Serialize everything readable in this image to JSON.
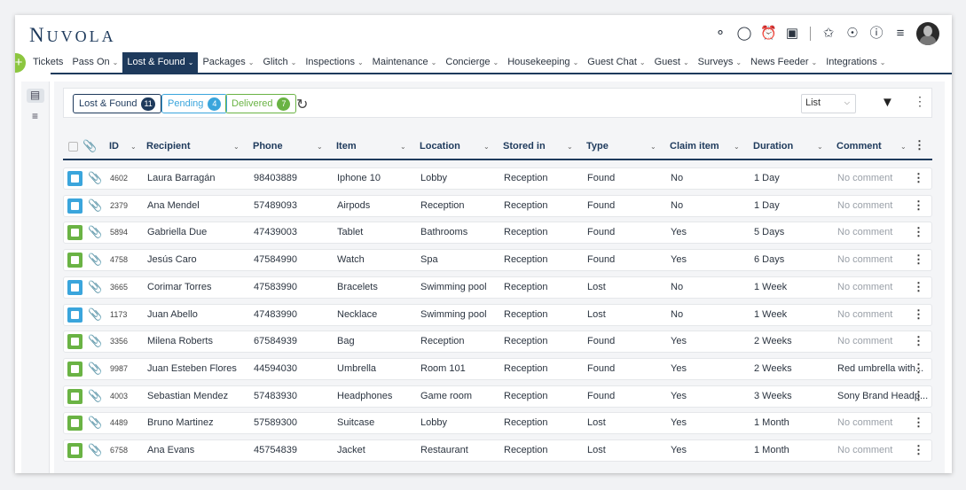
{
  "app": {
    "logo_first": "N",
    "logo_rest": "UVOLA"
  },
  "nav": {
    "plus": "+",
    "items": [
      {
        "label": "Tickets"
      },
      {
        "label": "Pass On"
      },
      {
        "label": "Lost & Found"
      },
      {
        "label": "Packages"
      },
      {
        "label": "Glitch"
      },
      {
        "label": "Inspections"
      },
      {
        "label": "Maintenance"
      },
      {
        "label": "Concierge"
      },
      {
        "label": "Housekeeping"
      },
      {
        "label": "Guest Chat"
      },
      {
        "label": "Guest"
      },
      {
        "label": "Surveys"
      },
      {
        "label": "News Feeder"
      },
      {
        "label": "Integrations"
      }
    ],
    "active_index": 2
  },
  "header_icons": [
    "chat-bubble-icon",
    "message-icon",
    "alarm-clock-icon",
    "calendar-icon",
    "magic-wand-icon",
    "globe-icon",
    "help-icon",
    "settings-sliders-icon"
  ],
  "toolbar": {
    "lost_found_label": "Lost & Found",
    "lost_found_count": "11",
    "pending_label": "Pending",
    "pending_count": "4",
    "delivered_label": "Delivered",
    "delivered_count": "7",
    "view_value": "List"
  },
  "columns": {
    "id": "ID",
    "recipient": "Recipient",
    "phone": "Phone",
    "item": "Item",
    "location": "Location",
    "stored_in": "Stored in",
    "type": "Type",
    "claim_item": "Claim item",
    "duration": "Duration",
    "comment": "Comment"
  },
  "colors": {
    "brand": "#1e3a5c",
    "pending": "#3aa5dc",
    "delivered": "#6ab344",
    "add_button": "#8cc63f"
  },
  "rows": [
    {
      "status": "pending",
      "id": "4602",
      "recipient": "Laura Barragán",
      "phone": "98403889",
      "item": "Iphone 10",
      "location": "Lobby",
      "stored_in": "Reception",
      "type": "Found",
      "claim": "No",
      "duration": "1 Day",
      "comment": "No comment",
      "comment_empty": true
    },
    {
      "status": "pending",
      "id": "2379",
      "recipient": "Ana Mendel",
      "phone": "57489093",
      "item": "Airpods",
      "location": "Reception",
      "stored_in": "Reception",
      "type": "Found",
      "claim": "No",
      "duration": "1 Day",
      "comment": "No comment",
      "comment_empty": true
    },
    {
      "status": "delivered",
      "id": "5894",
      "recipient": "Gabriella Due",
      "phone": "47439003",
      "item": "Tablet",
      "location": "Bathrooms",
      "stored_in": "Reception",
      "type": "Found",
      "claim": "Yes",
      "duration": "5 Days",
      "comment": "No comment",
      "comment_empty": true
    },
    {
      "status": "delivered",
      "id": "4758",
      "recipient": "Jesús Caro",
      "phone": "47584990",
      "item": "Watch",
      "location": "Spa",
      "stored_in": "Reception",
      "type": "Found",
      "claim": "Yes",
      "duration": "6 Days",
      "comment": "No comment",
      "comment_empty": true
    },
    {
      "status": "pending",
      "id": "3665",
      "recipient": "Corimar Torres",
      "phone": "47583990",
      "item": "Bracelets",
      "location": "Swimming pool",
      "stored_in": "Reception",
      "type": "Lost",
      "claim": "No",
      "duration": "1 Week",
      "comment": "No comment",
      "comment_empty": true
    },
    {
      "status": "pending",
      "id": "1173",
      "recipient": "Juan Abello",
      "phone": "47483990",
      "item": "Necklace",
      "location": "Swimming pool",
      "stored_in": "Reception",
      "type": "Lost",
      "claim": "No",
      "duration": "1 Week",
      "comment": "No comment",
      "comment_empty": true
    },
    {
      "status": "delivered",
      "id": "3356",
      "recipient": "Milena Roberts",
      "phone": "67584939",
      "item": "Bag",
      "location": "Reception",
      "stored_in": "Reception",
      "type": "Found",
      "claim": "Yes",
      "duration": "2 Weeks",
      "comment": "No comment",
      "comment_empty": true
    },
    {
      "status": "delivered",
      "id": "9987",
      "recipient": "Juan Esteben Flores",
      "phone": "44594030",
      "item": "Umbrella",
      "location": "Room 101",
      "stored_in": "Reception",
      "type": "Found",
      "claim": "Yes",
      "duration": "2 Weeks",
      "comment": "Red umbrella with...",
      "comment_empty": false
    },
    {
      "status": "delivered",
      "id": "4003",
      "recipient": "Sebastian Mendez",
      "phone": "57483930",
      "item": "Headphones",
      "location": "Game room",
      "stored_in": "Reception",
      "type": "Found",
      "claim": "Yes",
      "duration": "3 Weeks",
      "comment": "Sony Brand Headp...",
      "comment_empty": false
    },
    {
      "status": "delivered",
      "id": "4489",
      "recipient": "Bruno Martinez",
      "phone": "57589300",
      "item": "Suitcase",
      "location": "Lobby",
      "stored_in": "Reception",
      "type": "Lost",
      "claim": "Yes",
      "duration": "1 Month",
      "comment": "No comment",
      "comment_empty": true
    },
    {
      "status": "delivered",
      "id": "6758",
      "recipient": "Ana Evans",
      "phone": "45754839",
      "item": "Jacket",
      "location": "Restaurant",
      "stored_in": "Reception",
      "type": "Lost",
      "claim": "Yes",
      "duration": "1 Month",
      "comment": "No comment",
      "comment_empty": true
    }
  ]
}
